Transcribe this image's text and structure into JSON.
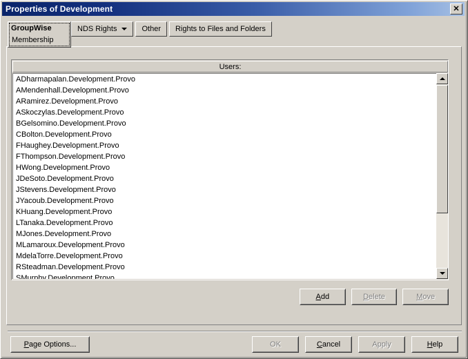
{
  "window": {
    "title": "Properties of Development",
    "close_label": "✕"
  },
  "tabs": {
    "active": {
      "label": "GroupWise",
      "sub_label": "Membership",
      "has_dropdown": true
    },
    "items": [
      {
        "label": "NDS Rights",
        "has_dropdown": true
      },
      {
        "label": "Other",
        "has_dropdown": false
      },
      {
        "label": "Rights to Files and Folders",
        "has_dropdown": false
      }
    ]
  },
  "list": {
    "header": "Users:",
    "rows": [
      "ADharmapalan.Development.Provo",
      "AMendenhall.Development.Provo",
      "ARamirez.Development.Provo",
      "ASkoczylas.Development.Provo",
      "BGelsomino.Development.Provo",
      "CBolton.Development.Provo",
      "FHaughey.Development.Provo",
      "FThompson.Development.Provo",
      "HWong.Development.Provo",
      "JDeSoto.Development.Provo",
      "JStevens.Development.Provo",
      "JYacoub.Development.Provo",
      "KHuang.Development.Provo",
      "LTanaka.Development.Provo",
      "MJones.Development.Provo",
      "MLamaroux.Development.Provo",
      "MdelaTorre.Development.Provo",
      "RSteadman.Development.Provo",
      "SMurphy.Development.Provo"
    ]
  },
  "list_actions": [
    {
      "label": "Add",
      "mnemonic": "A",
      "enabled": true
    },
    {
      "label": "Delete",
      "mnemonic": "D",
      "enabled": false
    },
    {
      "label": "Move",
      "mnemonic": "M",
      "enabled": false
    }
  ],
  "bottom_bar": {
    "page_options": {
      "label": "Page Options...",
      "mnemonic": "P",
      "enabled": true
    },
    "buttons": [
      {
        "label": "OK",
        "mnemonic": "",
        "enabled": false
      },
      {
        "label": "Cancel",
        "mnemonic": "C",
        "enabled": true
      },
      {
        "label": "Apply",
        "mnemonic": "",
        "enabled": false
      },
      {
        "label": "Help",
        "mnemonic": "H",
        "enabled": true
      }
    ]
  },
  "colors": {
    "face": "#d4d0c8",
    "titlebar_start": "#0a246a",
    "titlebar_end": "#a6c0e4",
    "list_background": "#ffffff",
    "disabled_text": "#808080"
  }
}
